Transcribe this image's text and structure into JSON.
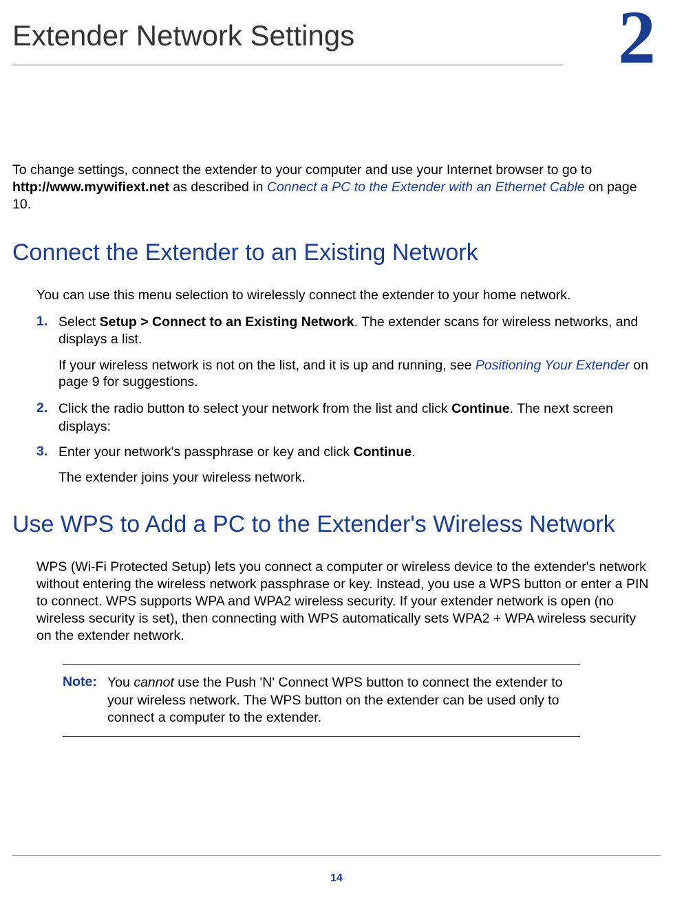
{
  "chapter": {
    "title": "Extender Network Settings",
    "number": "2"
  },
  "intro": {
    "text_before": "To change settings, connect the extender to your computer and use your Internet browser to go to ",
    "url": "http://www.mywifiext.net",
    "text_mid": " as described in ",
    "link": "Connect a PC to the Extender with an Ethernet Cable",
    "text_after": " on page 10."
  },
  "section1": {
    "heading": "Connect the Extender to an Existing Network",
    "intro": "You can use this menu selection to wirelessly connect the extender to your home network.",
    "steps": {
      "s1": {
        "num": "1.",
        "text_before": "Select ",
        "bold": "Setup > Connect to an Existing Network",
        "text_after": ". The extender scans for wireless networks, and displays a list.",
        "sub_before": "If your wireless network is not on the list, and it is up and running, see ",
        "sub_link": "Positioning Your Extender",
        "sub_after": " on page 9 for suggestions."
      },
      "s2": {
        "num": "2.",
        "text_before": "Click the radio button to select your network from the list and click ",
        "bold": "Continue",
        "text_after": ". The next screen displays:"
      },
      "s3": {
        "num": "3.",
        "text_before": "Enter your network's passphrase or key and click ",
        "bold": "Continue",
        "text_after": ".",
        "sub": "The extender joins your wireless network."
      }
    }
  },
  "section2": {
    "heading": "Use WPS to Add a PC to the Extender's Wireless Network",
    "para": "WPS (Wi-Fi Protected Setup) lets you connect a computer or wireless device to the extender's network without entering the wireless network passphrase or key. Instead, you use a WPS button or enter a PIN to connect. WPS supports WPA and WPA2 wireless security. If your extender network is open (no wireless security is set), then connecting with WPS automatically sets WPA2 + WPA wireless security on the extender network.",
    "note": {
      "label": "Note:",
      "text_before": "You ",
      "italic": "cannot",
      "text_after": " use the Push 'N' Connect WPS button to connect the extender to your wireless network. The WPS button on the extender can be used only to connect a computer to the extender."
    }
  },
  "page_number": "14"
}
